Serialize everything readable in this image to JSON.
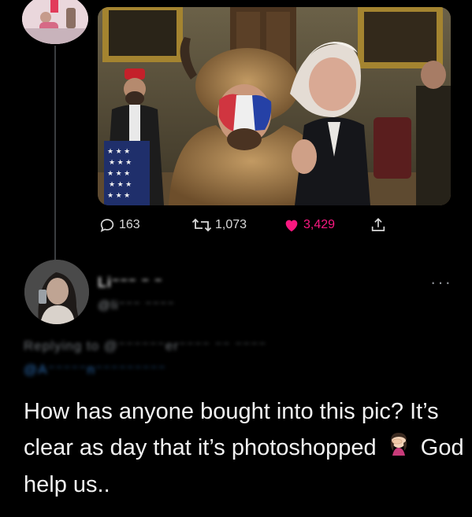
{
  "top_post": {
    "stats": {
      "replies": "163",
      "retweets": "1,073",
      "likes": "3,429"
    },
    "icons": {
      "reply": "speech-bubble-icon",
      "retweet": "retweet-arrows-icon",
      "like": "heart-icon",
      "share": "share-upload-icon"
    },
    "colors": {
      "like": "#f91880",
      "muted": "#8b8f94",
      "link": "#1d9bf0"
    }
  },
  "reply": {
    "display_name": "Li⁻⁻⁻ ⁻ ⁻",
    "handle": "@li⁻⁻⁻ ⁻⁻⁻⁻",
    "replying_to": "Replying to @⁻⁻⁻⁻⁻⁻er⁻⁻⁻⁻ ⁻⁻ ⁻⁻⁻⁻",
    "mention": "@A⁻⁻⁻⁻⁻n⁻⁻⁻⁻⁻⁻⁻⁻⁻",
    "more_label": "···",
    "text_part1": "How has anyone bought into this pic? It’s clear as day that it’s photoshopped",
    "emoji": "woman-facepalming-emoji",
    "text_part2": "God help us.."
  }
}
